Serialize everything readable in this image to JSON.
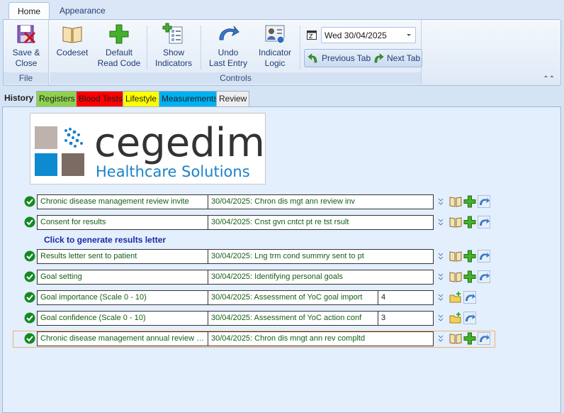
{
  "ribbon": {
    "tabs": [
      "Home",
      "Appearance"
    ],
    "file_group": {
      "label": "File",
      "save_close": [
        "Save &",
        "Close"
      ]
    },
    "controls_group": {
      "label": "Controls",
      "buttons": [
        {
          "l1": "Codeset",
          "l2": ""
        },
        {
          "l1": "Default",
          "l2": "Read Code"
        },
        {
          "l1": "Show",
          "l2": "Indicators"
        },
        {
          "l1": "Undo",
          "l2": "Last Entry"
        },
        {
          "l1": "Indicator",
          "l2": "Logic"
        }
      ],
      "date": "Wed 30/04/2025",
      "previous_tab": "Previous Tab",
      "next_tab": "Next Tab"
    }
  },
  "section_tabs": [
    {
      "label": "History",
      "color": "#dce9f8"
    },
    {
      "label": "Registers",
      "color": "#8fd14f"
    },
    {
      "label": "Blood Tests",
      "color": "#ff0000"
    },
    {
      "label": "Lifestyle",
      "color": "#ffff00"
    },
    {
      "label": "Measurements",
      "color": "#00b0f0"
    },
    {
      "label": "Review",
      "color": "#eeeeee"
    }
  ],
  "logo": {
    "company": "cegedim",
    "tagline": "Healthcare Solutions"
  },
  "generate_link": "Click to generate results letter",
  "entries": [
    {
      "label": "Chronic disease management review invite",
      "code": "30/04/2025: Chron dis mgt ann review inv",
      "value": null
    },
    {
      "label": "Consent for results",
      "code": "30/04/2025: Cnst gvn cntct pt re tst rsult",
      "value": null
    },
    {
      "label": "Results letter sent to patient",
      "code": "30/04/2025: Lng trm cond summry sent to pt",
      "value": null
    },
    {
      "label": "Goal setting",
      "code": "30/04/2025: Identifying personal goals",
      "value": null
    },
    {
      "label": "Goal importance (Scale 0 - 10)",
      "code": "30/04/2025: Assessment of YoC goal import",
      "value": "4"
    },
    {
      "label": "Goal confidence (Scale 0 - 10)",
      "code": "30/04/2025: Assessment of YoC action conf",
      "value": "3"
    },
    {
      "label": "Chronic disease management annual review completed",
      "code": "30/04/2025: Chron dis mngt ann rev compltd",
      "value": null
    }
  ],
  "colors": {
    "green_text": "#155d15",
    "link_blue": "#1b2aa3",
    "selection": "#f2ae74"
  }
}
